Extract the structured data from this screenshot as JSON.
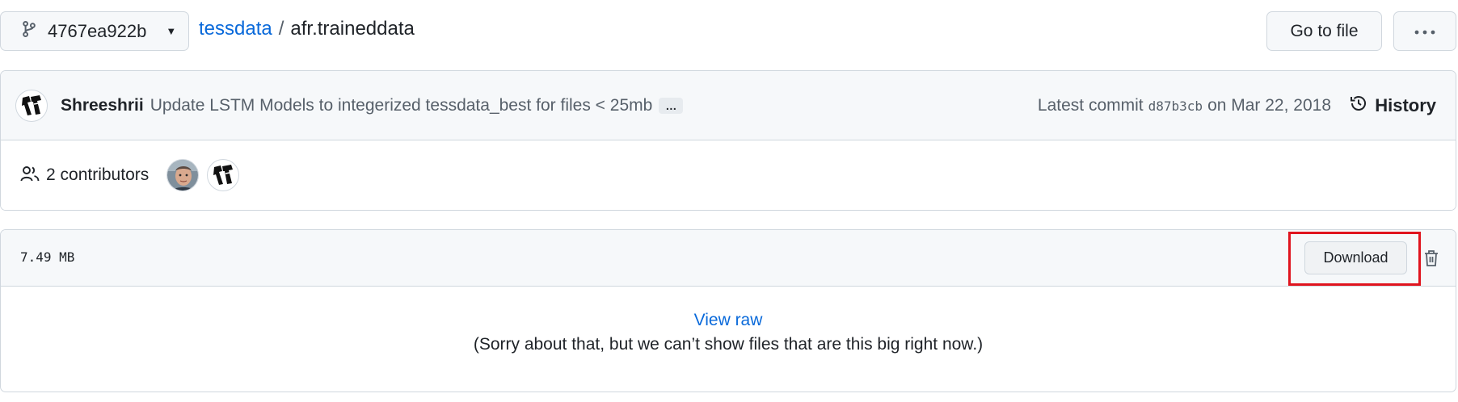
{
  "branch": {
    "name": "4767ea922b",
    "icon": "git-branch-icon"
  },
  "breadcrumb": {
    "repo": "tessdata",
    "separator": "/",
    "file": "afr.traineddata"
  },
  "actions": {
    "go_to_file": "Go to file",
    "more_icon": "kebab-horizontal-icon"
  },
  "commit": {
    "author": "Shreeshrii",
    "message": "Update LSTM Models to integerized tessdata_best for files < 25mb",
    "expand": "…",
    "latest_label": "Latest commit",
    "sha": "d87b3cb",
    "date": "on Mar 22, 2018",
    "history_label": "History"
  },
  "contributors": {
    "count": "2",
    "label": "contributors"
  },
  "file": {
    "size": "7.49 MB",
    "download_label": "Download",
    "view_raw": "View raw",
    "too_big_message": "(Sorry about that, but we can’t show files that are this big right now.)"
  },
  "colors": {
    "link": "#0969da",
    "highlight": "#e0141e",
    "border": "#d0d7de",
    "muted_bg": "#f6f8fa"
  }
}
